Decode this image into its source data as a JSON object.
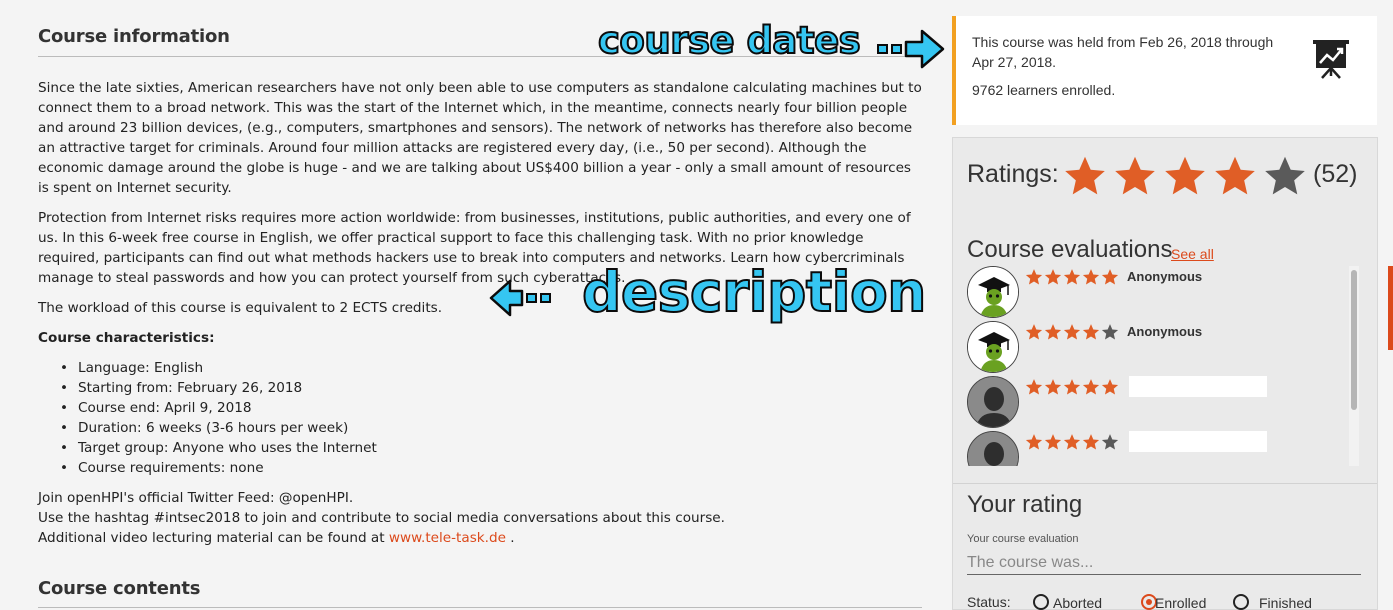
{
  "course_info": {
    "title": "Course information",
    "paragraphs": [
      "Since the late sixties, American researchers have not only been able to use computers as standalone calculating machines but to connect them to a broad network. This was the start of the Internet which, in the meantime, connects nearly four billion people and around 23 billion devices, (e.g., computers, smartphones and sensors). The network of networks has therefore also become an attractive target for criminals. Around four million attacks are registered every day, (i.e., 50 per second). Although the economic damage around the globe is huge - and we are talking about US$400 billion a year - only a small amount of resources is spent on Internet security.",
      "Protection from Internet risks requires more action worldwide: from businesses, institutions, public authorities, and every one of us. In this 6-week free course in English, we offer practical support to face this challenging task. With no prior knowledge required, participants can find out what methods hackers use to break into computers and networks. Learn how cybercriminals manage to steal passwords and how you can protect yourself from such cyberattacks.",
      "The workload of this course is equivalent to 2 ECTS credits."
    ],
    "characteristics_title": "Course characteristics:",
    "characteristics": [
      "Language: English",
      "Starting from: February 26, 2018",
      "Course end: April 9, 2018",
      "Duration: 6 weeks (3-6 hours per week)",
      "Target group: Anyone who uses the Internet",
      "Course requirements: none"
    ],
    "footer_lines": [
      "Join openHPI's official Twitter Feed: @openHPI.",
      "Use the hashtag #intsec2018 to join and contribute to social media conversations about this course."
    ],
    "video_line_prefix": "Additional video lecturing material can be found at ",
    "video_link": "www.tele-task.de",
    "video_line_suffix": " ."
  },
  "course_contents": {
    "title": "Course contents"
  },
  "annotations": {
    "dates": "course dates",
    "description": "description"
  },
  "dates_box": {
    "held_text": "This course was held from Feb 26, 2018 through Apr 27, 2018.",
    "enrolled_text": "9762 learners enrolled.",
    "icon": "presentation-chart-icon"
  },
  "ratings": {
    "label": "Ratings:",
    "stars": 4,
    "max_stars": 5,
    "count": "(52)"
  },
  "evaluations": {
    "title": "Course evaluations",
    "see_all": "See all",
    "items": [
      {
        "stars": 5,
        "name": "Anonymous",
        "avatar": "graduate-avatar"
      },
      {
        "stars": 4,
        "name": "Anonymous",
        "avatar": "graduate-avatar"
      },
      {
        "stars": 5,
        "name": "",
        "avatar": "person-avatar"
      },
      {
        "stars": 4,
        "name": "",
        "avatar": "person-avatar"
      }
    ]
  },
  "your_rating": {
    "title": "Your rating",
    "field_label": "Your course evaluation",
    "placeholder": "The course was...",
    "status_label": "Status:",
    "options": [
      "Aborted",
      "Enrolled",
      "Finished"
    ],
    "selected": "Enrolled"
  },
  "colors": {
    "accent": "#dc4a1c",
    "star_on": "#e05e26",
    "star_off": "#5a5a5a",
    "dates_border": "#f2a021",
    "annotation": "#35c6f2"
  }
}
